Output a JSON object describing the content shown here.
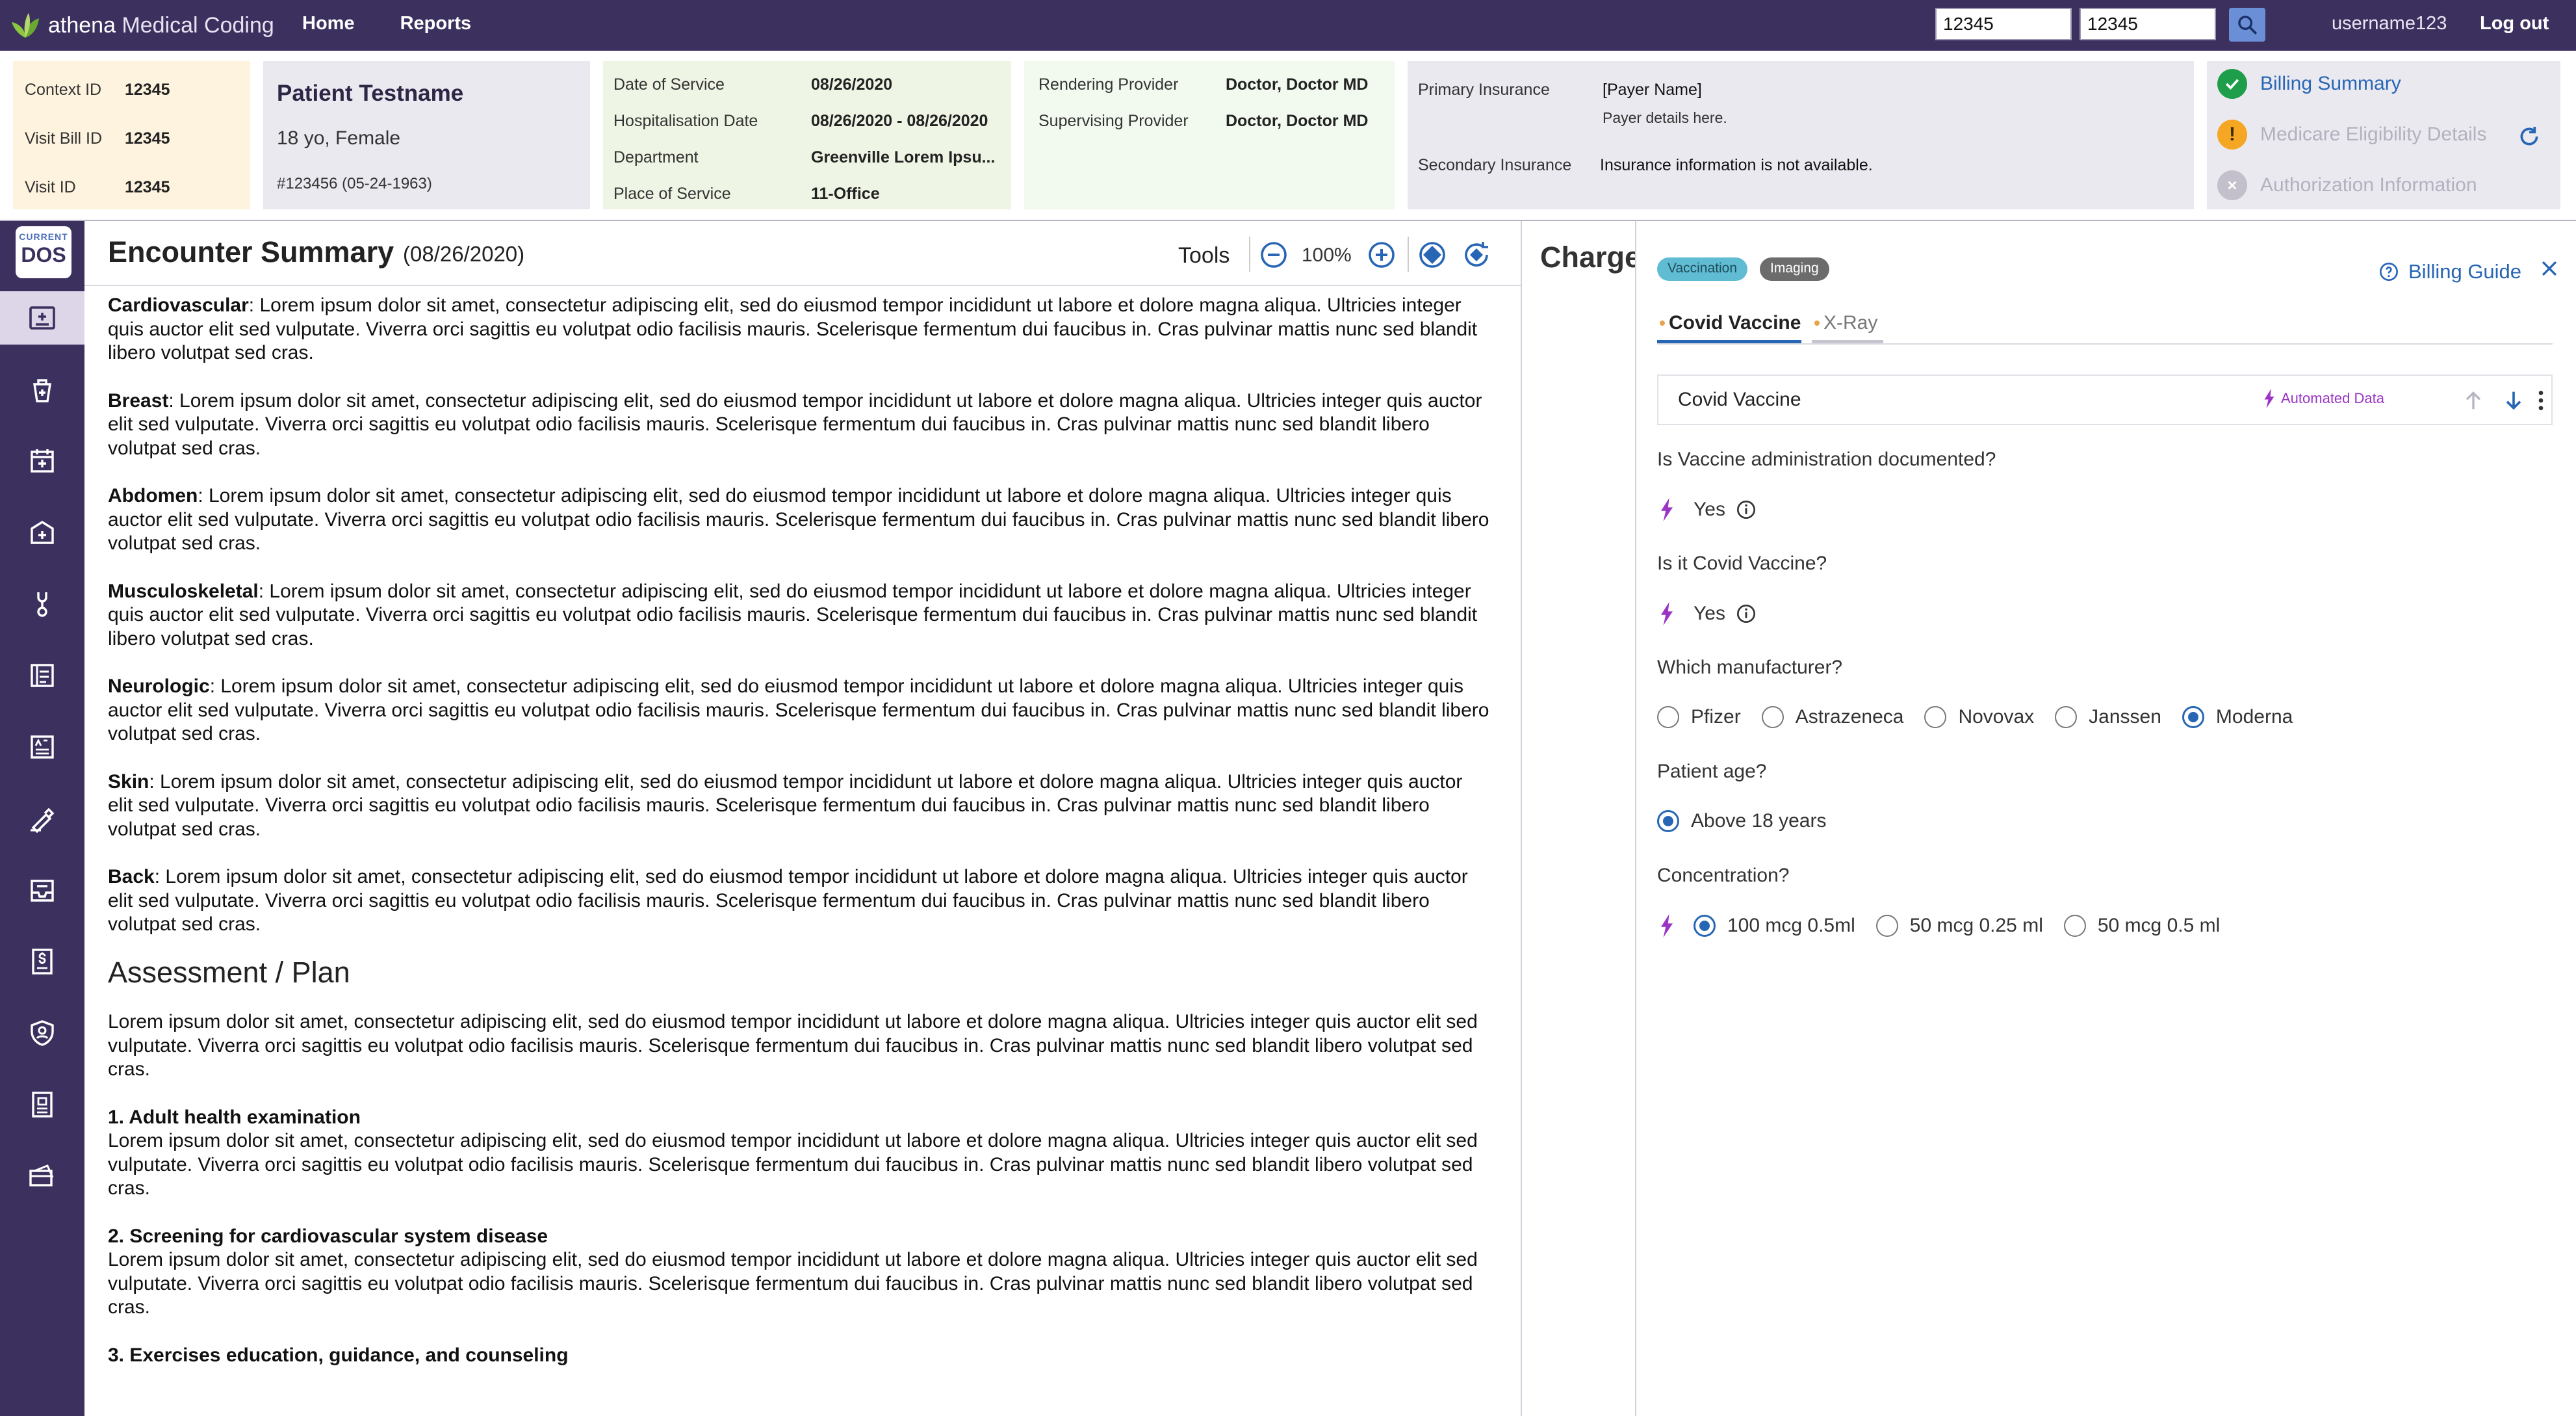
{
  "topbar": {
    "brand_prefix": "athena",
    "brand_suffix": " Medical Coding",
    "nav": [
      "Home",
      "Reports"
    ],
    "input1_value": "12345",
    "input2_value": "12345",
    "username": "username123",
    "logout": "Log out"
  },
  "context": {
    "ids": [
      {
        "label": "Context ID",
        "value": "12345"
      },
      {
        "label": "Visit Bill ID",
        "value": "12345"
      },
      {
        "label": "Visit ID",
        "value": "12345"
      }
    ],
    "patient": {
      "name": "Patient Testname",
      "age_sex": "18 yo, Female",
      "mrn": "#123456  (05-24-1963)"
    },
    "dates": [
      {
        "label": "Date of Service",
        "value": "08/26/2020"
      },
      {
        "label": "Hospitalisation Date",
        "value": "08/26/2020 - 08/26/2020"
      },
      {
        "label": "Department",
        "value": "Greenville Lorem Ipsu..."
      },
      {
        "label": "Place of Service",
        "value": "11-Office"
      }
    ],
    "providers": [
      {
        "label": "Rendering Provider",
        "value": "Doctor, Doctor MD"
      },
      {
        "label": "Supervising Provider",
        "value": "Doctor, Doctor MD"
      }
    ],
    "insurance": {
      "primary_label": "Primary Insurance",
      "primary_value": "[Payer Name]",
      "primary_detail": "Payer details here.",
      "secondary_label": "Secondary Insurance",
      "secondary_value": "Insurance information is not available."
    },
    "links": [
      {
        "label": "Billing Summary",
        "status": "ok"
      },
      {
        "label": "Medicare Eligibility Details",
        "status": "warn"
      },
      {
        "label": "Authorization Information",
        "status": "off"
      }
    ]
  },
  "sidebar": {
    "dos_top": "CURRENT",
    "dos_main": "DOS",
    "icons": [
      "encounter-icon",
      "medication-bag-icon",
      "calendar-icon",
      "medical-kit-icon",
      "stethoscope-icon",
      "notes-icon",
      "ab-test-icon",
      "pen-sign-icon",
      "inbox-icon",
      "billing-icon",
      "user-shield-icon",
      "id-card-icon",
      "card-icon"
    ]
  },
  "document": {
    "title": "Encounter Summary",
    "date": "(08/26/2020)",
    "tools_label": "Tools",
    "zoom": "100%",
    "sections": [
      {
        "label": "Cardiovascular",
        "text": ": Lorem ipsum dolor sit amet, consectetur adipiscing elit, sed do eiusmod tempor incididunt ut labore et dolore magna aliqua. Ultricies integer quis auctor elit sed vulputate. Viverra orci sagittis eu volutpat odio facilisis mauris. Scelerisque fermentum dui faucibus in. Cras pulvinar mattis nunc sed blandit libero volutpat sed cras."
      },
      {
        "label": "Breast",
        "text": ": Lorem ipsum dolor sit amet, consectetur adipiscing elit, sed do eiusmod tempor incididunt ut labore et dolore magna aliqua. Ultricies integer quis auctor elit sed vulputate. Viverra orci sagittis eu volutpat odio facilisis mauris. Scelerisque fermentum dui faucibus in. Cras pulvinar mattis nunc sed blandit libero volutpat sed cras."
      },
      {
        "label": "Abdomen",
        "text": ": Lorem ipsum dolor sit amet, consectetur adipiscing elit, sed do eiusmod tempor incididunt ut labore et dolore magna aliqua. Ultricies integer quis auctor elit sed vulputate. Viverra orci sagittis eu volutpat odio facilisis mauris. Scelerisque fermentum dui faucibus in. Cras pulvinar mattis nunc sed blandit libero volutpat sed cras."
      },
      {
        "label": "Musculoskeletal",
        "text": ": Lorem ipsum dolor sit amet, consectetur adipiscing elit, sed do eiusmod tempor incididunt ut labore et dolore magna aliqua. Ultricies integer quis auctor elit sed vulputate. Viverra orci sagittis eu volutpat odio facilisis mauris. Scelerisque fermentum dui faucibus in. Cras pulvinar mattis nunc sed blandit libero volutpat sed cras."
      },
      {
        "label": "Neurologic",
        "text": ": Lorem ipsum dolor sit amet, consectetur adipiscing elit, sed do eiusmod tempor incididunt ut labore et dolore magna aliqua. Ultricies integer quis auctor elit sed vulputate. Viverra orci sagittis eu volutpat odio facilisis mauris. Scelerisque fermentum dui faucibus in. Cras pulvinar mattis nunc sed blandit libero volutpat sed cras."
      },
      {
        "label": "Skin",
        "text": ": Lorem ipsum dolor sit amet, consectetur adipiscing elit, sed do eiusmod tempor incididunt ut labore et dolore magna aliqua. Ultricies integer quis auctor elit sed vulputate. Viverra orci sagittis eu volutpat odio facilisis mauris. Scelerisque fermentum dui faucibus in. Cras pulvinar mattis nunc sed blandit libero volutpat sed cras."
      },
      {
        "label": "Back",
        "text": ": Lorem ipsum dolor sit amet, consectetur adipiscing elit, sed do eiusmod tempor incididunt ut labore et dolore magna aliqua. Ultricies integer quis auctor elit sed vulputate. Viverra orci sagittis eu volutpat odio facilisis mauris. Scelerisque fermentum dui faucibus in. Cras pulvinar mattis nunc sed blandit libero volutpat sed cras."
      }
    ],
    "plan_heading": "Assessment / Plan",
    "plan_intro": "Lorem ipsum dolor sit amet, consectetur adipiscing elit, sed do eiusmod tempor incididunt ut labore et dolore magna aliqua. Ultricies integer quis auctor elit sed vulputate. Viverra orci sagittis eu volutpat odio facilisis mauris. Scelerisque fermentum dui faucibus in. Cras pulvinar mattis nunc sed blandit libero volutpat sed cras.",
    "plan_items": [
      {
        "title": "1. Adult health examination",
        "text": "Lorem ipsum dolor sit amet, consectetur adipiscing elit, sed do eiusmod tempor incididunt ut labore et dolore magna aliqua. Ultricies integer quis auctor elit sed vulputate. Viverra orci sagittis eu volutpat odio facilisis mauris. Scelerisque fermentum dui faucibus in. Cras pulvinar mattis nunc sed blandit libero volutpat sed cras."
      },
      {
        "title": "2. Screening for cardiovascular system disease",
        "text": "Lorem ipsum dolor sit amet, consectetur adipiscing elit, sed do eiusmod tempor incididunt ut labore et dolore magna aliqua. Ultricies integer quis auctor elit sed vulputate. Viverra orci sagittis eu volutpat odio facilisis mauris. Scelerisque fermentum dui faucibus in. Cras pulvinar mattis nunc sed blandit libero volutpat sed cras."
      },
      {
        "title": "3. Exercises education, guidance, and counseling",
        "text": ""
      }
    ]
  },
  "charge": {
    "title": "Charges"
  },
  "drawer": {
    "chips": [
      "Vaccination",
      "Imaging"
    ],
    "billing_guide": "Billing Guide",
    "tabs": [
      "Covid Vaccine",
      "X-Ray"
    ],
    "question_header": "Covid Vaccine",
    "automated": "Automated Data",
    "q1": "Is Vaccine administration documented?",
    "a1": "Yes",
    "q2": "Is it Covid Vaccine?",
    "a2": "Yes",
    "q3": "Which manufacturer?",
    "manufacturers": [
      "Pfizer",
      "Astrazeneca",
      "Novovax",
      "Janssen",
      "Moderna"
    ],
    "manufacturer_selected": "Moderna",
    "q4": "Patient age?",
    "age_option": "Above 18 years",
    "q5": "Concentration?",
    "concentrations": [
      "100 mcg 0.5ml",
      "50 mcg 0.25 ml",
      "50 mcg 0.5 ml"
    ],
    "concentration_selected": "100 mcg 0.5ml"
  },
  "colors": {
    "topbar": "#3c305f",
    "accent": "#2766b5",
    "automated": "#9b34c4",
    "ok": "#1e9e4a",
    "warn": "#f5a623"
  }
}
